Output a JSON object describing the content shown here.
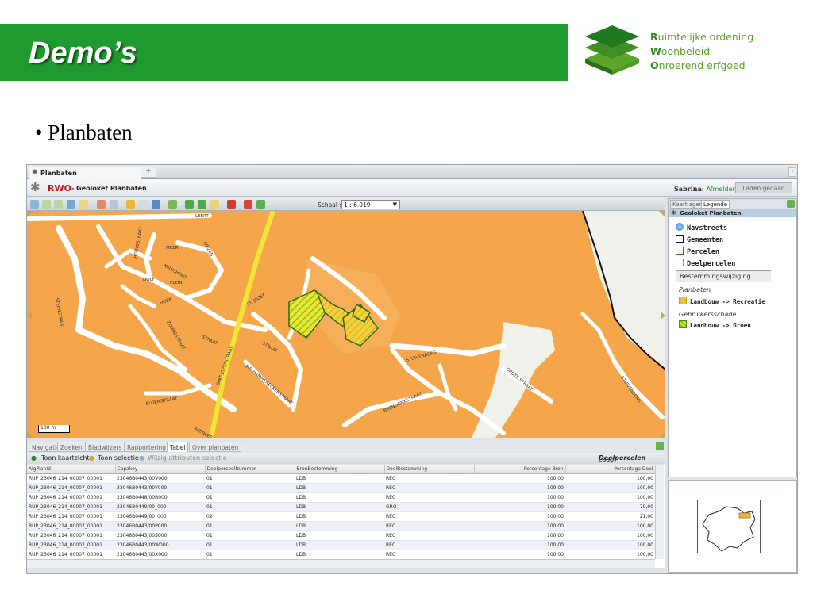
{
  "slide": {
    "title": "Demo’s",
    "logo": {
      "line1_initial": "R",
      "line1_rest": "uimtelijke ordening",
      "line2_initial": "W",
      "line2_rest": "oonbeleid",
      "line3_initial": "O",
      "line3_rest": "nroerend erfgoed"
    },
    "bullet": "• Planbaten"
  },
  "app": {
    "tab_label": "Planbaten",
    "new_tab": "+",
    "brand": "RWO",
    "app_title": "- Geoloket Planbaten",
    "user": "Sabrina:",
    "logout": "Afmelden",
    "loaded_button": "Laden gedaan",
    "scale_label": "Schaal :",
    "scale_value": "1 : 6.019",
    "scalebar": "100 m"
  },
  "colors": {
    "banner": "#1f9a2f",
    "parcel": "#f5a64b",
    "road": "#ffffff",
    "highlight": "#f0e534",
    "hatch": "#7fc31e",
    "accent": "#c3161c"
  },
  "bottom_tabs": [
    "Navigatie",
    "Zoeken",
    "Bladwijzers",
    "Rapportering",
    "Tabel",
    "Over planbaten"
  ],
  "grid_toolbar": {
    "show_map": "Toon kaartzicht",
    "show_selection": "Toon selectie",
    "edit_attributes": "Wijzig attributen selectie",
    "layer_label": "Laag:",
    "layer_name": "Deelpercelen"
  },
  "table": {
    "columns": [
      "AlgPlanId",
      "Capakey",
      "DeelperceelNummer",
      "BronBestemming",
      "DoelBestemming",
      "Percentage Bron",
      "Percentage Doel"
    ],
    "rows": [
      [
        "RUP_23046_214_00007_00001",
        "23046B0443/00V000",
        "01",
        "LDB",
        "REC",
        "100,00",
        "100,00"
      ],
      [
        "RUP_23046_214_00007_00001",
        "23046B0443/00Y000",
        "01",
        "LDB",
        "REC",
        "100,00",
        "100,00"
      ],
      [
        "RUP_23046_214_00007_00001",
        "23046B0448/00B000",
        "01",
        "LDB",
        "REC",
        "100,00",
        "100,00"
      ],
      [
        "RUP_23046_214_00007_00001",
        "23046B0449/00_000",
        "01",
        "LDB",
        "GRO",
        "100,00",
        "79,00"
      ],
      [
        "RUP_23046_214_00007_00001",
        "23046B0449/00_000",
        "02",
        "LDB",
        "REC",
        "100,00",
        "21,00"
      ],
      [
        "RUP_23046_214_00007_00001",
        "23046B0443/00P000",
        "01",
        "LDB",
        "REC",
        "100,00",
        "100,00"
      ],
      [
        "RUP_23046_214_00007_00001",
        "23046B0443/00S000",
        "01",
        "LDB",
        "REC",
        "100,00",
        "100,00"
      ],
      [
        "RUP_23046_214_00007_00001",
        "23046B0443/00W000",
        "01",
        "LDB",
        "REC",
        "100,00",
        "100,00"
      ],
      [
        "RUP_23046_214_00007_00001",
        "23046B0443/00X000",
        "01",
        "LDB",
        "REC",
        "100,00",
        "100,00"
      ]
    ]
  },
  "right_panel": {
    "tabs": [
      "Kaartlagen",
      "Legende"
    ],
    "header": "Geoloket Planbaten",
    "legend": [
      "Navstreets",
      "Gemeenten",
      "Percelen",
      "Deelpercelen"
    ],
    "group_title": "Bestemmingswijziging",
    "sub1_title": "Planbaten",
    "sub1_item": "Landbouw -> Recreatie",
    "sub2_title": "Gebruikersschade",
    "sub2_item": "Landbouw -> Groen"
  },
  "map_labels": {
    "l1": "MEER",
    "l2": "BIEZEN",
    "l3": "KRUISHOUT",
    "l4": "DOLF",
    "l5": "PLEIN",
    "l6": "HOEK",
    "l7": "ZONNESTRAAT",
    "l8": "STRAAT",
    "l9": "ST. JOZEF",
    "l10": "STRAAT",
    "l11": "SINT-JOZEFSTRAAT",
    "l12": "STUIVENBERG",
    "l13": "BLOEMSTRAAT",
    "l14": "JAN HAMMENECKERSTRAAT",
    "l15": "BRENDONKSTRAAT",
    "l16": "GROTE STRAAT",
    "l17": "STUIVENBERG",
    "l18": "HOEVESTRAAT",
    "l19": "STEENSTRAAT",
    "l20": "AVENUESTRAAT",
    "l21": "LEERT"
  }
}
